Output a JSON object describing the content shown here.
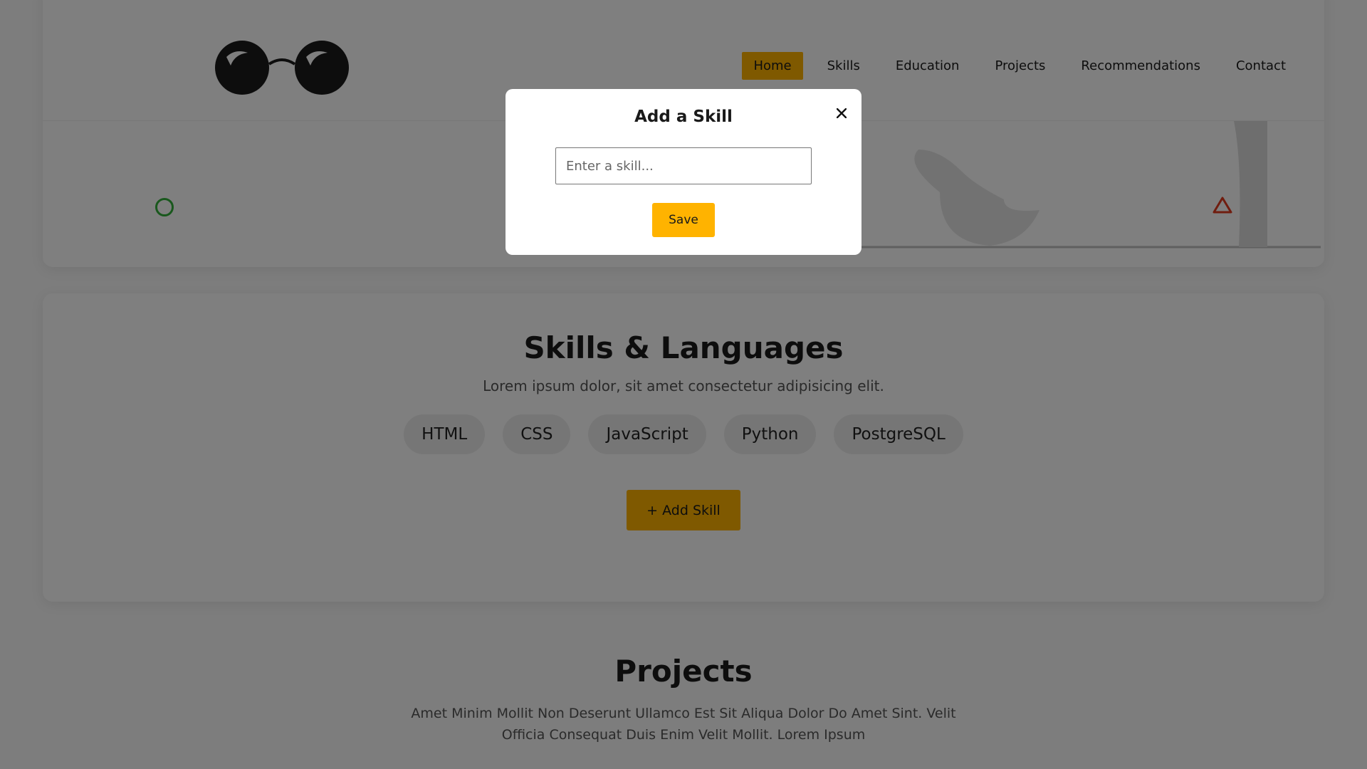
{
  "nav": {
    "items": [
      {
        "label": "Home",
        "active": true
      },
      {
        "label": "Skills",
        "active": false
      },
      {
        "label": "Education",
        "active": false
      },
      {
        "label": "Projects",
        "active": false
      },
      {
        "label": "Recommendations",
        "active": false
      },
      {
        "label": "Contact",
        "active": false
      }
    ]
  },
  "skills": {
    "title": "Skills & Languages",
    "subtitle": "Lorem ipsum dolor, sit amet consectetur adipisicing elit.",
    "chips": [
      "HTML",
      "CSS",
      "JavaScript",
      "Python",
      "PostgreSQL"
    ],
    "add_button_label": "+ Add Skill"
  },
  "projects": {
    "title": "Projects",
    "subtitle": "Amet Minim Mollit Non Deserunt Ullamco Est Sit Aliqua Dolor Do Amet Sint. Velit Officia Consequat Duis Enim Velit Mollit. Lorem Ipsum"
  },
  "modal": {
    "title": "Add a Skill",
    "input_placeholder": "Enter a skill...",
    "input_value": "",
    "save_label": "Save",
    "close_icon": "close-icon"
  },
  "colors": {
    "accent": "#ffb300",
    "deco_circle": "#33b03a",
    "deco_triangle": "#e03a1e",
    "overlay": "rgba(0,0,0,0.5)"
  }
}
